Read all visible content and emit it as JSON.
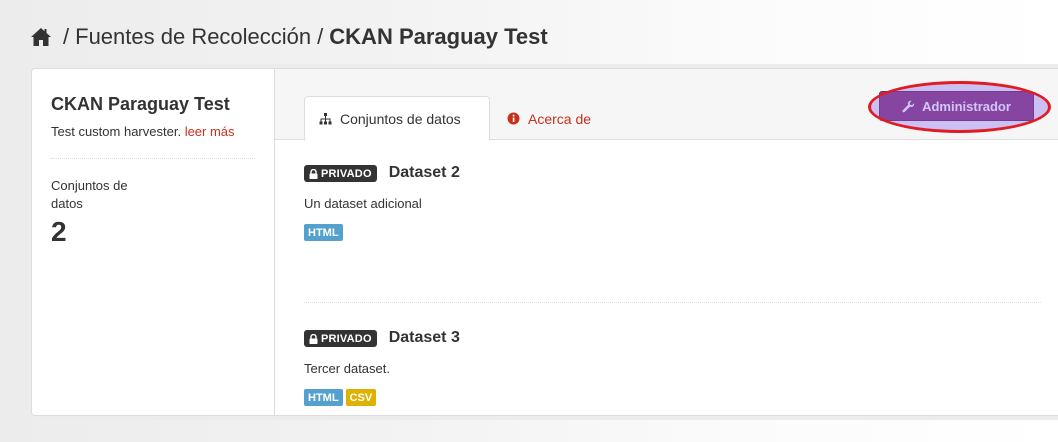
{
  "breadcrumb": {
    "home_icon": "home-icon",
    "separator": "/",
    "parent": "Fuentes de Recolección",
    "current": "CKAN Paraguay Test"
  },
  "sidebar": {
    "title": "CKAN Paraguay Test",
    "description": "Test custom harvester.",
    "read_more": "leer más",
    "stat_label": "Conjuntos de datos",
    "stat_value": "2"
  },
  "tabs": [
    {
      "label": "Conjuntos de datos",
      "icon": "sitemap-icon",
      "active": true
    },
    {
      "label": "Acerca de",
      "icon": "info-circle-icon",
      "active": false
    }
  ],
  "admin_button": {
    "label": "Administrador",
    "icon": "wrench-icon"
  },
  "datasets": [
    {
      "badge": "Privado",
      "title": "Dataset 2",
      "description": "Un dataset adicional",
      "formats": [
        "HTML"
      ]
    },
    {
      "badge": "Privado",
      "title": "Dataset 3",
      "description": "Tercer dataset.",
      "formats": [
        "HTML",
        "CSV"
      ]
    }
  ],
  "colors": {
    "link": "#c6311a",
    "admin_button": "#8c3a7c",
    "highlight_ring": "#e01b24",
    "format_html": "#55a1ce",
    "format_csv": "#dfb100"
  }
}
